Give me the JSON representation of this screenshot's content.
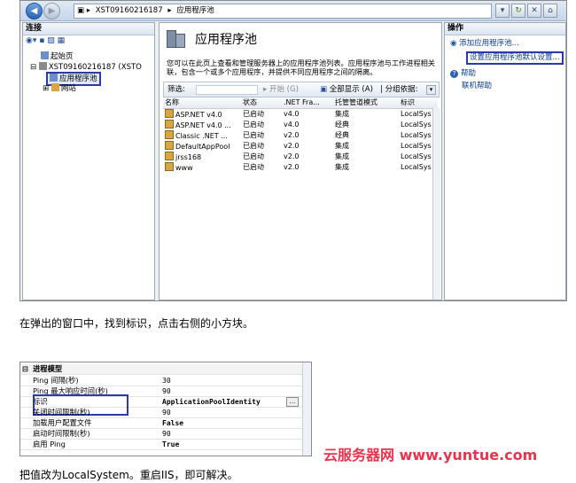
{
  "iis": {
    "address": [
      "XST09160216187",
      "应用程序池"
    ],
    "connections": {
      "header": "连接",
      "tree": [
        "起始页",
        "XST09160216187 (XSTO",
        "应用程序池",
        "网站"
      ]
    },
    "center": {
      "title": "应用程序池",
      "description": "您可以在此页上查看和管理服务器上的应用程序池列表。应用程序池与工作进程相关联，包含一个或多个应用程序，并提供不同应用程序之间的隔离。",
      "filter_label": "筛选:",
      "start_label": "开始 (G)",
      "show_all_label": "全部显示 (A)",
      "group_label": "分组依据:",
      "columns": [
        "名称",
        "状态",
        ".NET Fra...",
        "托管管道模式",
        "标识"
      ],
      "rows": [
        [
          "ASP.NET v4.0",
          "已启动",
          "v4.0",
          "集成",
          "LocalSys"
        ],
        [
          "ASP.NET v4.0 ...",
          "已启动",
          "v4.0",
          "经典",
          "LocalSys"
        ],
        [
          "Classic .NET ...",
          "已启动",
          "v2.0",
          "经典",
          "LocalSys"
        ],
        [
          "DefaultAppPool",
          "已启动",
          "v2.0",
          "集成",
          "LocalSys"
        ],
        [
          "jrss168",
          "已启动",
          "v2.0",
          "集成",
          "LocalSys"
        ],
        [
          "www",
          "已启动",
          "v2.0",
          "集成",
          "LocalSys"
        ]
      ]
    },
    "actions": {
      "header": "操作",
      "items": [
        "添加应用程序池...",
        "设置应用程序池默认设置...",
        "帮助",
        "联机帮助"
      ]
    }
  },
  "text1": "在弹出的窗口中，找到标识，点击右侧的小方块。",
  "prop": {
    "section": "进程模型",
    "rows": [
      [
        "Ping 间隔(秒)",
        "30"
      ],
      [
        "Ping 最大响应时间(秒)",
        "90"
      ],
      [
        "标识",
        "ApplicationPoolIdentity"
      ],
      [
        "关闭时间限制(秒)",
        "90"
      ],
      [
        "加载用户配置文件",
        "False"
      ],
      [
        "启动时间限制(秒)",
        "90"
      ],
      [
        "启用 Ping",
        "True"
      ]
    ]
  },
  "watermark": "云服务器网 www.yuntue.com",
  "text2": "把值改为LocalSystem。重启IIS，即可解决。"
}
